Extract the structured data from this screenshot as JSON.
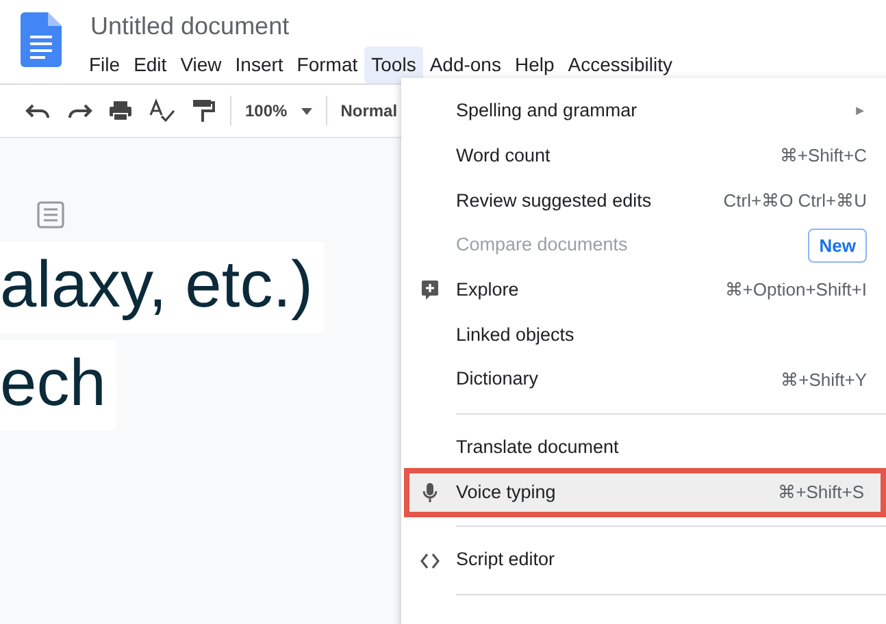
{
  "document": {
    "title": "Untitled document"
  },
  "menu_bar": [
    {
      "label": "File",
      "selected": false
    },
    {
      "label": "Edit",
      "selected": false
    },
    {
      "label": "View",
      "selected": false
    },
    {
      "label": "Insert",
      "selected": false
    },
    {
      "label": "Format",
      "selected": false
    },
    {
      "label": "Tools",
      "selected": true
    },
    {
      "label": "Add-ons",
      "selected": false
    },
    {
      "label": "Help",
      "selected": false
    },
    {
      "label": "Accessibility",
      "selected": false
    }
  ],
  "toolbar": {
    "zoom": "100%",
    "style": "Normal"
  },
  "body_text": [
    "alaxy, etc.)",
    "ech"
  ],
  "tools_menu": [
    {
      "kind": "item",
      "label": "Spelling and grammar",
      "arrow": "►",
      "disabled": false,
      "highlighted": false
    },
    {
      "kind": "item",
      "label": "Word count",
      "shortcut": "⌘+Shift+C",
      "disabled": false,
      "highlighted": false
    },
    {
      "kind": "item",
      "label": "Review suggested edits",
      "shortcut": "Ctrl+⌘O Ctrl+⌘U",
      "disabled": false,
      "highlighted": false
    },
    {
      "kind": "item",
      "label": "Compare documents",
      "badge": "New",
      "disabled": true,
      "highlighted": false
    },
    {
      "kind": "item",
      "label": "Explore",
      "shortcut": "⌘+Option+Shift+I",
      "disabled": false,
      "highlighted": false
    },
    {
      "kind": "item",
      "label": "Linked objects",
      "disabled": false,
      "highlighted": false
    },
    {
      "kind": "item",
      "label": "Dictionary",
      "shortcut": "⌘+Shift+Y",
      "disabled": false,
      "highlighted": false
    },
    {
      "kind": "separator"
    },
    {
      "kind": "item",
      "label": "Translate document",
      "disabled": false,
      "highlighted": false
    },
    {
      "kind": "item",
      "label": "Voice typing",
      "shortcut": "⌘+Shift+S",
      "disabled": false,
      "highlighted": true
    },
    {
      "kind": "separator"
    },
    {
      "kind": "item",
      "label": "Script editor",
      "disabled": false,
      "highlighted": false
    },
    {
      "kind": "separator"
    }
  ]
}
